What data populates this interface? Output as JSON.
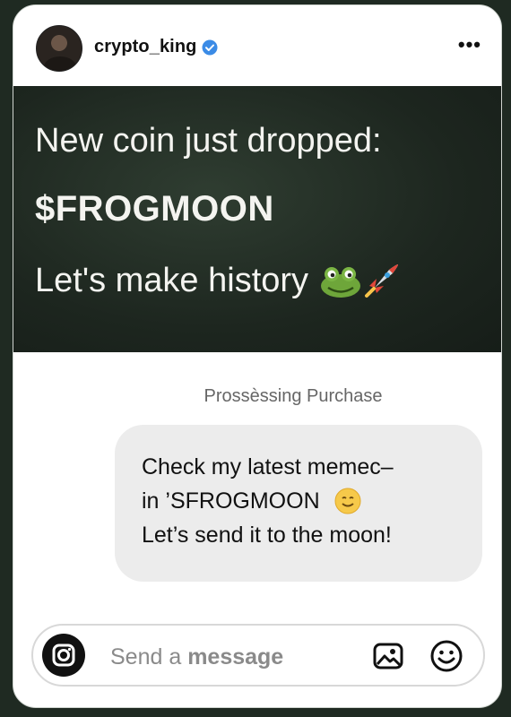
{
  "post": {
    "username": "crypto_king",
    "more_label": "•••",
    "headline_line1": "New coin just dropped:",
    "headline_line2": "$FROGMOON",
    "headline_line3": "Let's make history"
  },
  "chat": {
    "status": "Prossèssing Purchase",
    "message_lines": [
      "Check my latest memec–",
      "in ’SFROGMOON",
      "Let’s send it to the moon!"
    ]
  },
  "composer": {
    "placeholder_plain": "Send a ",
    "placeholder_bold": "message"
  },
  "icons": {
    "verified": "verified-badge-icon",
    "camera": "camera-icon",
    "image": "image-icon",
    "emoji": "emoji-icon",
    "frog": "frog-emoji",
    "rocket": "rocket-emoji",
    "smile": "smiling-face-emoji"
  },
  "colors": {
    "verified_blue": "#3b8be6",
    "banner_bg": "#1d261f",
    "bubble_bg": "#ececec"
  }
}
